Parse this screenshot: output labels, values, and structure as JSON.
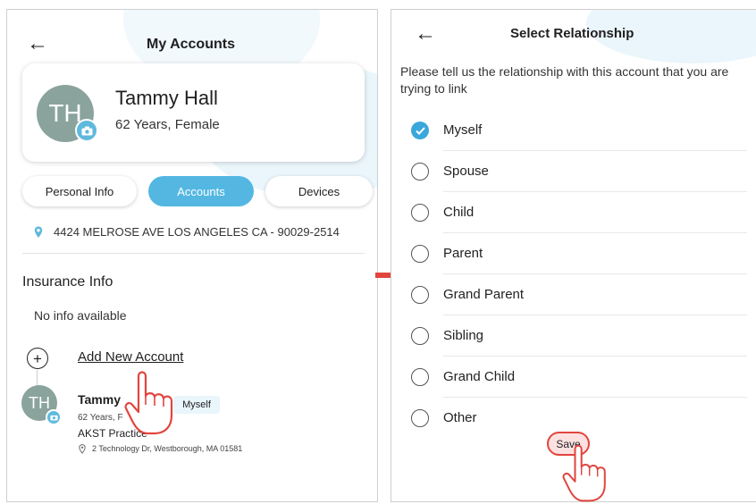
{
  "left": {
    "title": "My Accounts",
    "back_icon": "arrow-left-icon",
    "profile": {
      "initials": "TH",
      "name": "Tammy Hall",
      "details": "62 Years, Female"
    },
    "tabs": [
      {
        "label": "Personal Info",
        "active": false
      },
      {
        "label": "Accounts",
        "active": true
      },
      {
        "label": "Devices",
        "active": false
      }
    ],
    "address": "4424 MELROSE AVE LOS ANGELES CA - 90029-2514",
    "insurance": {
      "heading": "Insurance Info",
      "empty_text": "No info available"
    },
    "add_account_label": "Add New Account",
    "linked_account": {
      "initials": "TH",
      "name": "Tammy",
      "details": "62 Years, F",
      "badge": "Myself",
      "practice": "AKST Practice",
      "address": "2 Technology Dr, Westborough, MA 01581"
    }
  },
  "right": {
    "title": "Select Relationship",
    "back_icon": "arrow-left-icon",
    "prompt": "Please tell us the relationship with this account that you are trying to link",
    "options": [
      {
        "label": "Myself",
        "selected": true
      },
      {
        "label": "Spouse",
        "selected": false
      },
      {
        "label": "Child",
        "selected": false
      },
      {
        "label": "Parent",
        "selected": false
      },
      {
        "label": "Grand Parent",
        "selected": false
      },
      {
        "label": "Sibling",
        "selected": false
      },
      {
        "label": "Grand Child",
        "selected": false
      },
      {
        "label": "Other",
        "selected": false
      }
    ],
    "save_label": "Save"
  },
  "colors": {
    "accent": "#53b7e2",
    "avatar": "#8aa39d",
    "highlight": "#e1453e"
  }
}
